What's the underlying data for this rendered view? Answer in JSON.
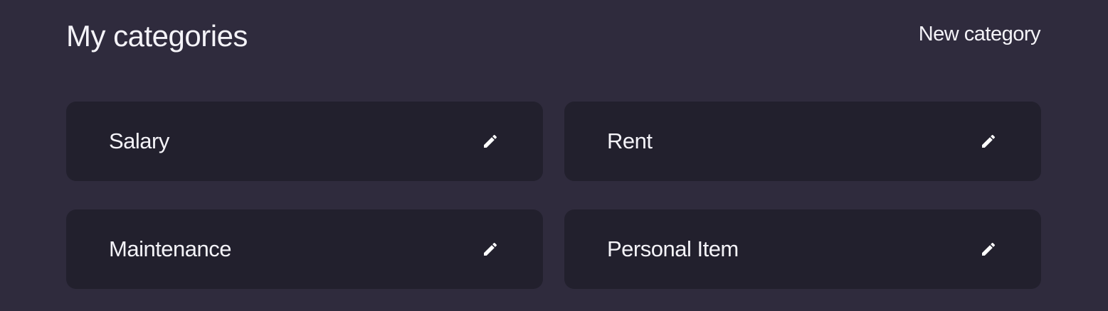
{
  "header": {
    "title": "My categories",
    "new_category_label": "New category"
  },
  "categories": [
    {
      "label": "Salary",
      "icon": "pencil-icon"
    },
    {
      "label": "Rent",
      "icon": "pencil-icon"
    },
    {
      "label": "Maintenance",
      "icon": "pencil-icon"
    },
    {
      "label": "Personal Item",
      "icon": "pencil-icon"
    }
  ],
  "colors": {
    "page_background": "#2f2b3d",
    "card_background": "#22202d",
    "text": "#f4f3f8"
  }
}
